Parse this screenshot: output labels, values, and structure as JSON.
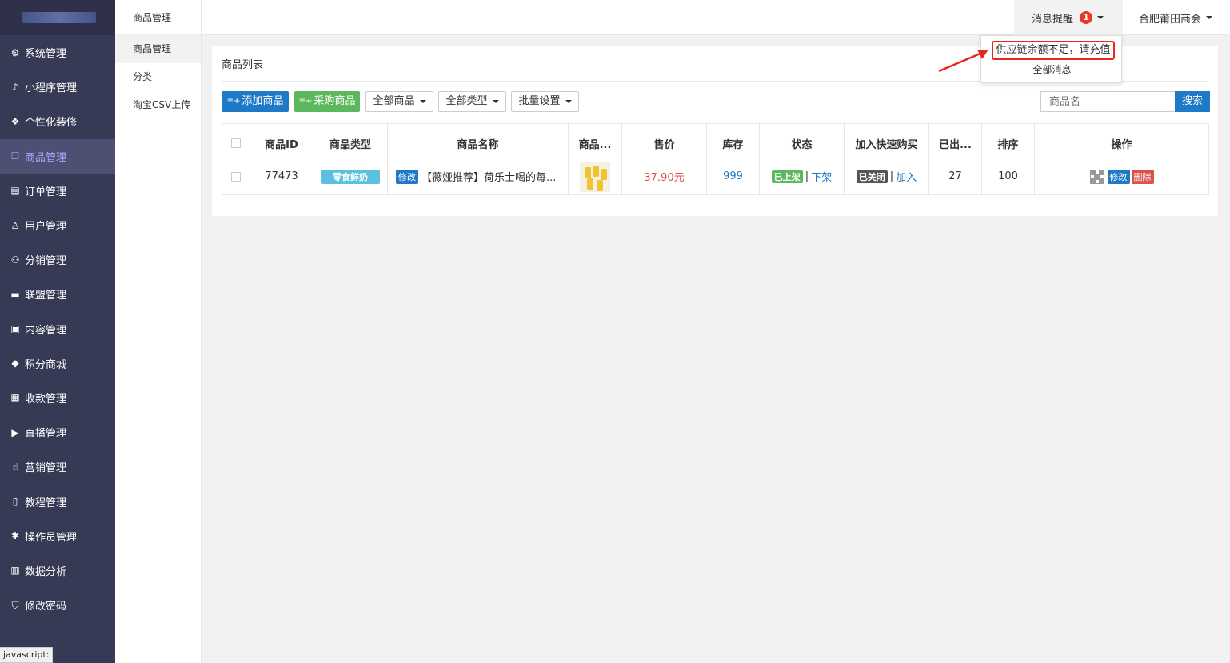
{
  "sidebar": {
    "items": [
      {
        "label": "系统管理",
        "icon": "⚙",
        "name": "sidebar-item-system"
      },
      {
        "label": "小程序管理",
        "icon": "♪",
        "name": "sidebar-item-miniprogram"
      },
      {
        "label": "个性化装修",
        "icon": "❖",
        "name": "sidebar-item-decoration"
      },
      {
        "label": "商品管理",
        "icon": "☐",
        "name": "sidebar-item-goods",
        "active": true
      },
      {
        "label": "订单管理",
        "icon": "▤",
        "name": "sidebar-item-orders"
      },
      {
        "label": "用户管理",
        "icon": "♙",
        "name": "sidebar-item-users"
      },
      {
        "label": "分销管理",
        "icon": "⚇",
        "name": "sidebar-item-distribution"
      },
      {
        "label": "联盟管理",
        "icon": "▬",
        "name": "sidebar-item-alliance"
      },
      {
        "label": "内容管理",
        "icon": "▣",
        "name": "sidebar-item-content"
      },
      {
        "label": "积分商城",
        "icon": "◆",
        "name": "sidebar-item-points-mall"
      },
      {
        "label": "收款管理",
        "icon": "▦",
        "name": "sidebar-item-payment"
      },
      {
        "label": "直播管理",
        "icon": "▶",
        "name": "sidebar-item-live"
      },
      {
        "label": "营销管理",
        "icon": "☝",
        "name": "sidebar-item-marketing"
      },
      {
        "label": "教程管理",
        "icon": "▯",
        "name": "sidebar-item-tutorial"
      },
      {
        "label": "操作员管理",
        "icon": "✱",
        "name": "sidebar-item-operators"
      },
      {
        "label": "数据分析",
        "icon": "▥",
        "name": "sidebar-item-analytics"
      },
      {
        "label": "修改密码",
        "icon": "⛉",
        "name": "sidebar-item-password"
      }
    ]
  },
  "subbar": {
    "title": "商品管理",
    "items": [
      "商品管理",
      "分类",
      "淘宝CSV上传"
    ]
  },
  "topbar": {
    "notice_label": "消息提醒",
    "notice_count": "1",
    "user_label": "合肥莆田商会"
  },
  "dropdown": {
    "item1": "供应链余额不足，请充值",
    "item2": "全部消息"
  },
  "panel": {
    "title": "商品列表",
    "add_btn": "添加商品",
    "purchase_btn": "采购商品",
    "all_goods": "全部商品",
    "all_types": "全部类型",
    "batch": "批量设置",
    "search_placeholder": "商品名",
    "search_btn": "搜索"
  },
  "table": {
    "headers": [
      "商品ID",
      "商品类型",
      "商品名称",
      "商品...",
      "售价",
      "库存",
      "状态",
      "加入快速购买",
      "已出...",
      "排序",
      "操作"
    ],
    "row": {
      "id": "77473",
      "type": "零食鲜奶",
      "edit_tag": "修改",
      "name": "【薇娅推荐】荷乐士喝的每...",
      "price": "37.90元",
      "stock": "999",
      "status_tag": "已上架",
      "status_link": "下架",
      "quick_tag": "已关闭",
      "quick_link": "加入",
      "sold": "27",
      "sort": "100",
      "op_edit": "修改",
      "op_delete": "删除"
    }
  },
  "statusbar": "javascript:",
  "colors": {
    "sidebar": "#373a55",
    "accent": "#1e79c6",
    "green": "#5cb85c",
    "red": "#d9534f",
    "badge": "#e8382c"
  }
}
